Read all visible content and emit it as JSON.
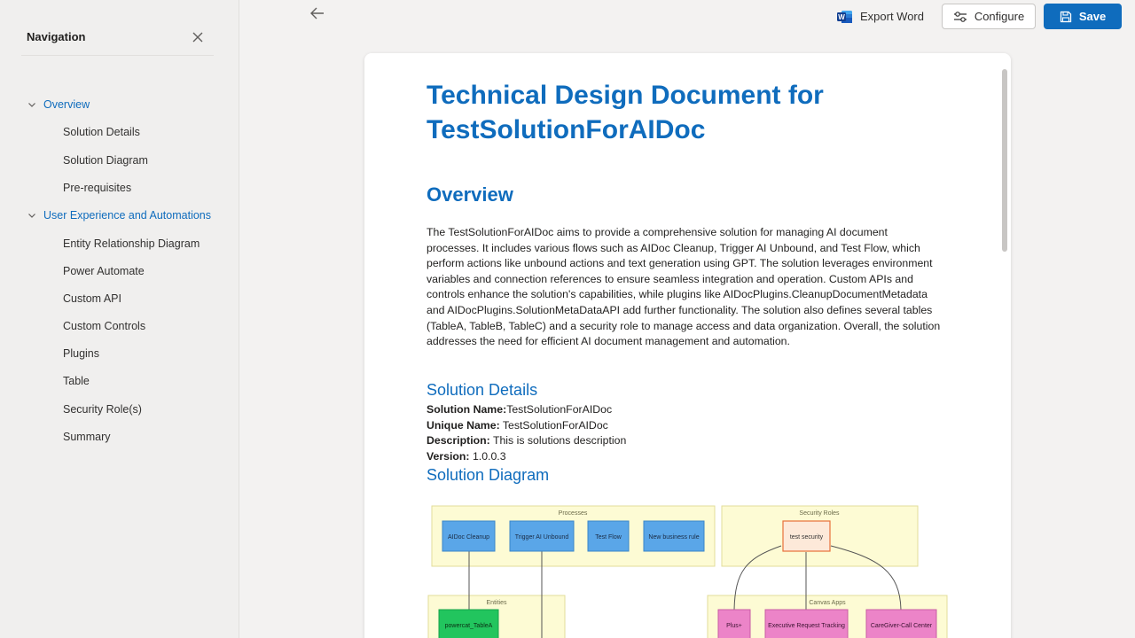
{
  "navigation": {
    "title": "Navigation",
    "items": [
      {
        "label": "Overview",
        "type": "section"
      },
      {
        "label": "Solution Details",
        "type": "item"
      },
      {
        "label": "Solution Diagram",
        "type": "item"
      },
      {
        "label": "Pre-requisites",
        "type": "item"
      },
      {
        "label": "User Experience and Automations",
        "type": "section"
      },
      {
        "label": "Entity Relationship Diagram",
        "type": "item"
      },
      {
        "label": "Power Automate",
        "type": "item"
      },
      {
        "label": "Custom API",
        "type": "item"
      },
      {
        "label": "Custom Controls",
        "type": "item"
      },
      {
        "label": "Plugins",
        "type": "item"
      },
      {
        "label": "Table",
        "type": "item"
      },
      {
        "label": "Security Role(s)",
        "type": "item"
      },
      {
        "label": "Summary",
        "type": "item"
      }
    ]
  },
  "toolbar": {
    "export_label": "Export Word",
    "configure_label": "Configure",
    "save_label": "Save"
  },
  "document": {
    "title": "Technical Design Document for TestSolutionForAIDoc",
    "overview_heading": "Overview",
    "overview_text": "The TestSolutionForAIDoc aims to provide a comprehensive solution for managing AI document processes. It includes various flows such as AIDoc Cleanup, Trigger AI Unbound, and Test Flow, which perform actions like unbound actions and text generation using GPT. The solution leverages environment variables and connection references to ensure seamless integration and operation. Custom APIs and controls enhance the solution's capabilities, while plugins like AIDocPlugins.CleanupDocumentMetadata and AIDocPlugins.SolutionMetaDataAPI add further functionality. The solution also defines several tables (TableA, TableB, TableC) and a security role to manage access and data organization. Overall, the solution addresses the need for efficient AI document management and automation.",
    "solution_details_heading": "Solution Details",
    "solution_details": {
      "name_label": "Solution Name:",
      "name_value": "TestSolutionForAIDoc",
      "unique_label": "Unique Name:",
      "unique_value": " TestSolutionForAIDoc",
      "desc_label": "Description:",
      "desc_value": " This is solutions description",
      "version_label": "Version:",
      "version_value": " 1.0.0.3"
    },
    "solution_diagram_heading": "Solution Diagram"
  },
  "diagram": {
    "groups": {
      "processes": "Processes",
      "security_roles": "Security Roles",
      "entities": "Entities",
      "canvas_apps": "Canvas Apps"
    },
    "processes": [
      "AIDoc Cleanup",
      "Trigger AI Unbound",
      "Test Flow",
      "New business rule"
    ],
    "security_role": "test security",
    "entities": [
      "powercat_TableA"
    ],
    "canvas_apps": [
      "Plus+",
      "Executive Request Tracking",
      "CareGiver-Call Center"
    ],
    "colors": {
      "group_fill": "#fdfbd4",
      "process_fill": "#5aa6e8",
      "entity_fill": "#22c55e",
      "role_fill": "#fde9d9",
      "role_stroke": "#e8703a",
      "app_fill": "#ec84c8",
      "accent": "#0f6cbd"
    }
  }
}
